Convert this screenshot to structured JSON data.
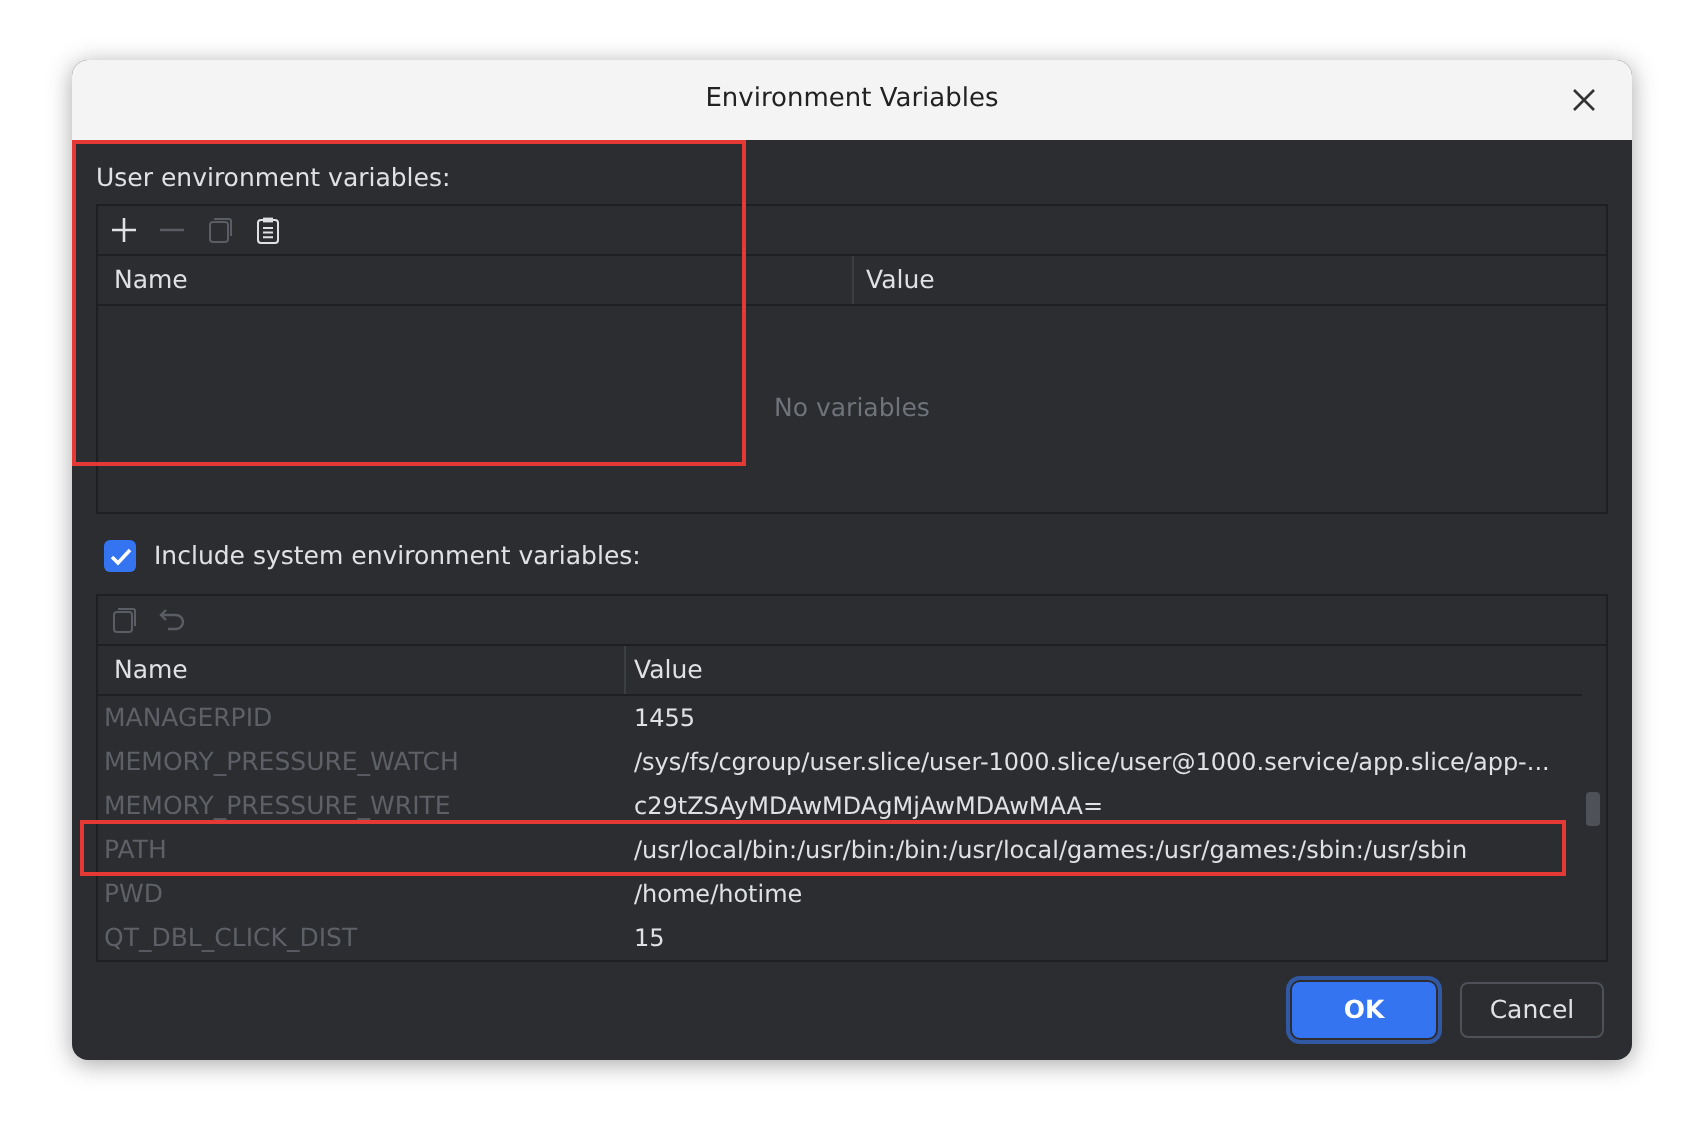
{
  "window": {
    "title": "Environment Variables"
  },
  "user_section": {
    "label": "User environment variables:",
    "columns": [
      "Name",
      "Value"
    ],
    "empty_text": "No variables"
  },
  "system_section": {
    "label": "Include system environment variables:",
    "checked": true,
    "columns": [
      "Name",
      "Value"
    ],
    "rows": [
      {
        "name": "MANAGERPID",
        "value": "1455"
      },
      {
        "name": "MEMORY_PRESSURE_WATCH",
        "value": "/sys/fs/cgroup/user.slice/user-1000.slice/user@1000.service/app.slice/app-..."
      },
      {
        "name": "MEMORY_PRESSURE_WRITE",
        "value": "c29tZSAyMDAwMDAgMjAwMDAwMAA="
      },
      {
        "name": "PATH",
        "value": "/usr/local/bin:/usr/bin:/bin:/usr/local/games:/usr/games:/sbin:/usr/sbin"
      },
      {
        "name": "PWD",
        "value": "/home/hotime"
      },
      {
        "name": "QT_DBL_CLICK_DIST",
        "value": "15"
      }
    ]
  },
  "buttons": [
    {
      "label": "OK",
      "kind": "primary"
    },
    {
      "label": "Cancel",
      "kind": "secondary"
    }
  ]
}
